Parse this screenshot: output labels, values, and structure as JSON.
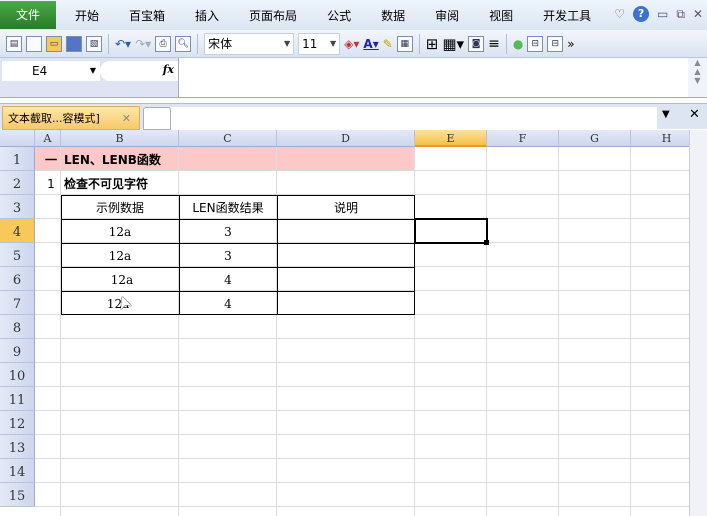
{
  "menu": {
    "items": [
      "文件",
      "开始",
      "百宝箱",
      "插入",
      "页面布局",
      "公式",
      "数据",
      "审阅",
      "视图",
      "开发工具"
    ]
  },
  "toolbar": {
    "font": "宋体",
    "size": "11"
  },
  "formula_bar": {
    "name_box": "E4",
    "fx": "fx",
    "value": ""
  },
  "tabs": {
    "active": "文本截取...容模式]"
  },
  "grid": {
    "columns": [
      "A",
      "B",
      "C",
      "D",
      "E",
      "F",
      "G",
      "H"
    ],
    "active_col": "E",
    "active_row": 4,
    "rows": [
      "1",
      "2",
      "3",
      "4",
      "5",
      "6",
      "7",
      "8",
      "9",
      "10",
      "11",
      "12",
      "13",
      "14",
      "15"
    ],
    "cells": {
      "A1": "一",
      "B1": "LEN、LENB函数",
      "A2": "1",
      "B2": "检查不可见字符",
      "B3": "示例数据",
      "C3": "LEN函数结果",
      "D3": "说明",
      "B4": "12a",
      "C4": "3",
      "B5": "12a",
      "C5": "3",
      "B6": " 12a",
      "C6": "4",
      "B7": "12a ",
      "C7": "4"
    }
  },
  "colors": {
    "title_fill": "#fcc8c8",
    "active_header": "#f8c85a"
  }
}
